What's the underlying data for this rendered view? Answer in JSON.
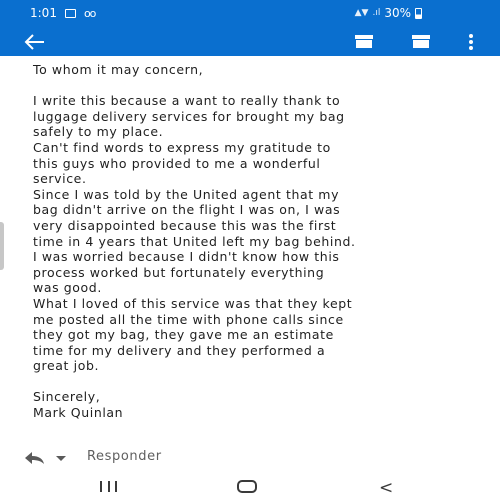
{
  "status_bar": {
    "time": "1:01",
    "battery_percent": "30%",
    "icons": [
      "image-notification-icon",
      "voicemail-icon",
      "wifi-icon",
      "signal-icon",
      "battery-icon"
    ]
  },
  "app_bar": {
    "icons": [
      "back-arrow-icon",
      "archive-icon",
      "archive-icon",
      "more-vert-icon"
    ],
    "color": "#0a6fcf"
  },
  "email": {
    "greeting": "To whom it may concern,",
    "lines": [
      "I write this because a want to really thank to",
      "luggage delivery services for brought my bag",
      "safely to my place.",
      "Can't find words to express my gratitude to",
      "this guys who provided to me a wonderful",
      "service.",
      "Since I was told by the United agent that my",
      "bag didn't arrive on the flight I was on, I was",
      "very disappointed because this was the first",
      "time in 4 years that United left my bag behind.",
      "I was worried because I didn't know how this",
      "process worked but fortunately everything",
      "was good.",
      "What I loved of this service was that they kept",
      "me posted all the time with phone calls since",
      "they got my bag, they gave me an estimate",
      "time for my delivery and they performed a",
      "great job."
    ],
    "closing": "Sincerely,",
    "signature": "Mark Quinlan"
  },
  "reply_bar": {
    "label": "Responder",
    "icons": [
      "reply-icon",
      "dropdown-caret-icon"
    ]
  },
  "nav_bar": {
    "icons": [
      "recent-apps-icon",
      "home-icon",
      "back-nav-icon"
    ]
  }
}
